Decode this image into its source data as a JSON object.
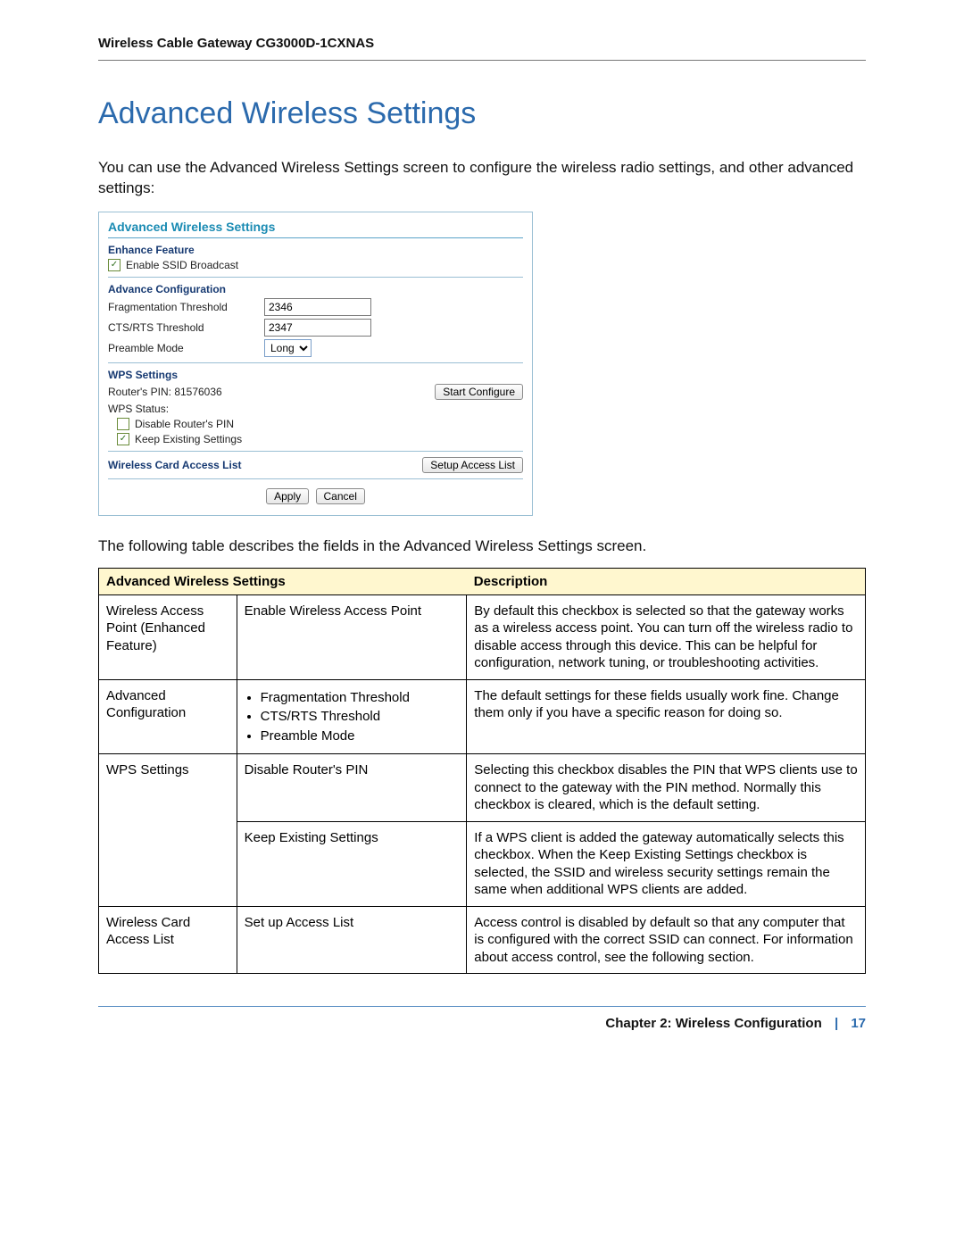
{
  "header": {
    "title": "Wireless Cable Gateway CG3000D-1CXNAS"
  },
  "main": {
    "title": "Advanced Wireless Settings",
    "intro": "You can use the Advanced Wireless Settings screen to configure the wireless radio settings, and other advanced settings:",
    "after_panel": "The following table describes the fields in the Advanced Wireless Settings screen."
  },
  "panel": {
    "title": "Advanced Wireless Settings",
    "enhance": {
      "heading": "Enhance Feature",
      "ssid_label": "Enable SSID Broadcast",
      "ssid_checked": true
    },
    "advcfg": {
      "heading": "Advance Configuration",
      "frag_label": "Fragmentation Threshold",
      "frag_value": "2346",
      "cts_label": "CTS/RTS Threshold",
      "cts_value": "2347",
      "preamble_label": "Preamble Mode",
      "preamble_value": "Long"
    },
    "wps": {
      "heading": "WPS Settings",
      "pin_label": "Router's PIN: 81576036",
      "start_btn": "Start Configure",
      "status_label": "WPS Status:",
      "disable_pin_label": "Disable Router's PIN",
      "disable_pin_checked": false,
      "keep_label": "Keep Existing Settings",
      "keep_checked": true
    },
    "access": {
      "heading": "Wireless Card Access List",
      "setup_btn": "Setup Access List"
    },
    "apply": "Apply",
    "cancel": "Cancel"
  },
  "table": {
    "h1": "Advanced Wireless Settings",
    "h2": "Description",
    "rows": [
      {
        "c1": "Wireless Access Point (Enhanced Feature)",
        "c2": "Enable Wireless Access Point",
        "c3": "By default this checkbox is selected so that the gateway works as a wireless access point. You can turn off the wireless radio to disable access through this device. This can be helpful for configuration, network tuning, or troubleshooting activities."
      },
      {
        "c1": "Advanced Configuration",
        "bullets": [
          "Fragmentation Threshold",
          "CTS/RTS Threshold",
          "Preamble Mode"
        ],
        "c3": "The default settings for these fields usually work fine. Change them only if you have a specific reason for doing so."
      },
      {
        "c1": "WPS Settings",
        "c2": "Disable Router's PIN",
        "c3": "Selecting this checkbox disables the PIN that WPS clients use to connect to the gateway with the PIN method. Normally this checkbox is cleared, which is the default setting."
      },
      {
        "c1": "",
        "c2": "Keep Existing Settings",
        "c3": "If a WPS client is added the gateway automatically selects this checkbox. When the Keep Existing Settings checkbox is selected, the SSID and wireless security settings remain the same when additional WPS clients are added."
      },
      {
        "c1": "Wireless Card Access List",
        "c2": "Set up Access List",
        "c3": "Access control is disabled by default so that any computer that is configured with the correct SSID can connect. For information about access control, see the following section."
      }
    ]
  },
  "footer": {
    "chapter": "Chapter 2:  Wireless Configuration",
    "sep": "|",
    "page": "17"
  }
}
